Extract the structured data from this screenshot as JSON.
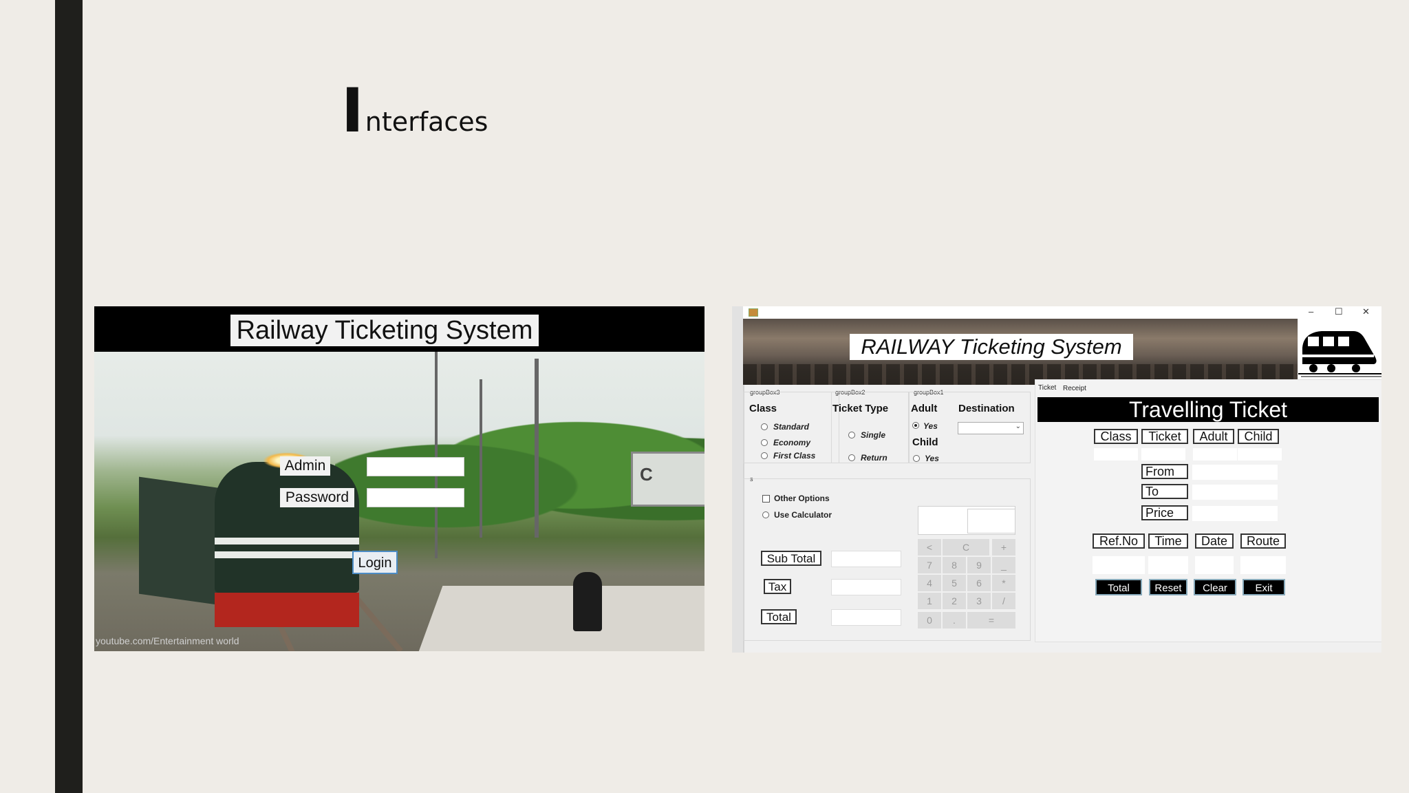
{
  "slide": {
    "title_initial": "I",
    "title_rest": "nterfaces"
  },
  "login_screen": {
    "app_title": "Railway Ticketing System",
    "admin_label": "Admin",
    "password_label": "Password",
    "login_button": "Login",
    "sign_text": "C",
    "watermark": "youtube.com/Entertainment world"
  },
  "ticketing_form": {
    "window_controls": [
      "–",
      "☐",
      "✕"
    ],
    "banner_title": "RAILWAY Ticketing System",
    "groupbox3": {
      "label": "groupBox3",
      "heading": "Class",
      "options": [
        {
          "label": "Standard",
          "selected": false
        },
        {
          "label": "Economy",
          "selected": false
        },
        {
          "label": "First Class",
          "selected": false
        }
      ]
    },
    "groupbox2": {
      "label": "groupBox2",
      "heading": "Ticket Type",
      "options": [
        {
          "label": "Single",
          "selected": false
        },
        {
          "label": "Return",
          "selected": false
        }
      ]
    },
    "groupbox1": {
      "label": "groupBox1",
      "adult_heading": "Adult",
      "adult_option": {
        "label": "Yes",
        "selected": true
      },
      "child_heading": "Child",
      "child_option": {
        "label": "Yes",
        "selected": false
      },
      "destination_heading": "Destination",
      "destination_value": ""
    },
    "options_group": {
      "label": "s",
      "other_options": "Other Options",
      "use_calculator": "Use Calculator"
    },
    "totals": {
      "sub_total": "Sub Total",
      "tax": "Tax",
      "total": "Total"
    },
    "calculator_keys": [
      "<",
      "C",
      "+",
      "7",
      "8",
      "9",
      "_",
      "4",
      "5",
      "6",
      "*",
      "1",
      "2",
      "3",
      "/",
      "0",
      ".",
      "="
    ],
    "tabs": [
      "Ticket",
      "Receipt"
    ],
    "ticket": {
      "title": "Travelling Ticket",
      "columns": [
        "Class",
        "Ticket",
        "Adult",
        "Child"
      ],
      "from": "From",
      "to": "To",
      "price": "Price",
      "columns2": [
        "Ref.No",
        "Time",
        "Date",
        "Route"
      ],
      "buttons": [
        "Total",
        "Reset",
        "Clear",
        "Exit"
      ]
    }
  },
  "colors": {
    "background": "#efece7",
    "left_bar": "#1f1f1c",
    "button_black": "#000000"
  }
}
